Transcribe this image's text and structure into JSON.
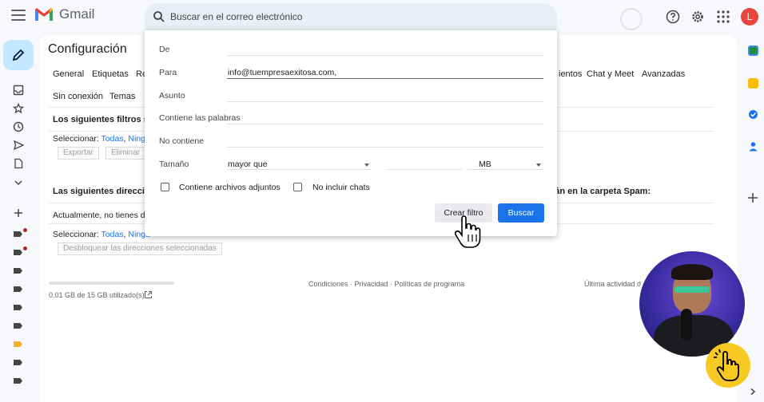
{
  "app": {
    "name": "Gmail",
    "avatar_letter": "L"
  },
  "search": {
    "placeholder": "Buscar en el correo electrónico"
  },
  "settings": {
    "title": "Configuración",
    "tabs_row1": [
      "General",
      "Etiquetas",
      "Re",
      "ientos",
      "Chat y Meet",
      "Avanzadas"
    ],
    "tabs_row2": [
      "Sin conexión",
      "Temas"
    ],
    "filters_section_title": "Los siguientes filtros se",
    "select_prefix": "Seleccionar:",
    "select_all": "Todas",
    "select_none": "Ning",
    "export_label": "Exportar",
    "delete_label": "Eliminar",
    "blocked_section_title_start": "Las siguientes direccio",
    "blocked_section_title_end": "rán en la carpeta Spam:",
    "blocked_status": "Actualmente, no tienes di",
    "select_none_2": "Ningu",
    "unblock_label": "Desbloquear las direcciones seleccionadas",
    "storage_text": "0.01 GB de 15 GB utilizado(s)",
    "footer_links": "Condiciones · Privacidad · Políticas de programa",
    "last_activity": "Última actividad d"
  },
  "filter_dialog": {
    "from_label": "De",
    "to_label": "Para",
    "to_value": "info@tuempresaexitosa.com,",
    "subject_label": "Asunto",
    "has_words_label": "Contiene las palabras",
    "not_contains_label": "No contiene",
    "size_label": "Tamaño",
    "size_operator": "mayor que",
    "size_unit": "MB",
    "has_attachment_label": "Contiene archivos adjuntos",
    "no_chats_label": "No incluir chats",
    "create_filter_label": "Crear filtro",
    "search_label": "Buscar"
  },
  "colors": {
    "accent": "#1a73e8",
    "compose": "#c2e7ff",
    "avatar": "#e8453c",
    "label_dot": "#c5221f",
    "label_orange": "#f6ae2d"
  }
}
